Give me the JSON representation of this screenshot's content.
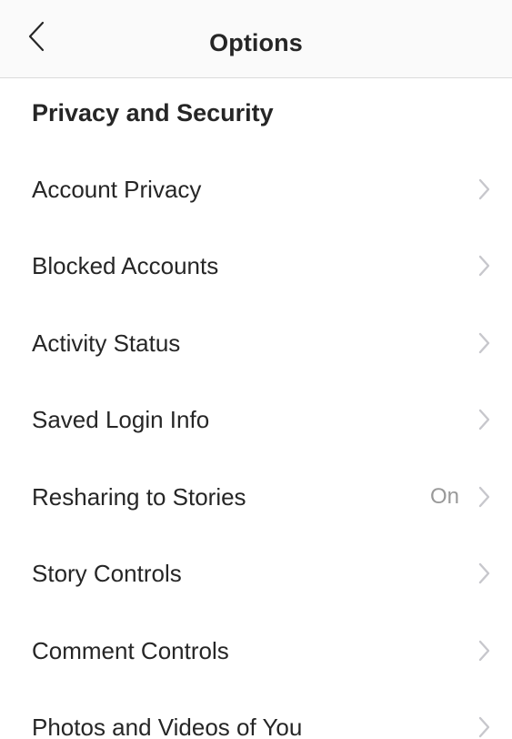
{
  "header": {
    "title": "Options",
    "back_icon": "chevron-left-icon"
  },
  "section": {
    "title": "Privacy and Security"
  },
  "items": [
    {
      "label": "Account Privacy",
      "value": "",
      "icon": "chevron-right-icon"
    },
    {
      "label": "Blocked Accounts",
      "value": "",
      "icon": "chevron-right-icon"
    },
    {
      "label": "Activity Status",
      "value": "",
      "icon": "chevron-right-icon"
    },
    {
      "label": "Saved Login Info",
      "value": "",
      "icon": "chevron-right-icon"
    },
    {
      "label": "Resharing to Stories",
      "value": "On",
      "icon": "chevron-right-icon"
    },
    {
      "label": "Story Controls",
      "value": "",
      "icon": "chevron-right-icon"
    },
    {
      "label": "Comment Controls",
      "value": "",
      "icon": "chevron-right-icon"
    },
    {
      "label": "Photos and Videos of You",
      "value": "",
      "icon": "chevron-right-icon"
    }
  ],
  "colors": {
    "header_background": "#fafafa",
    "divider": "#dbdbdb",
    "text": "#262626",
    "secondary_text": "#999999",
    "chevron": "#c7c7cc"
  }
}
